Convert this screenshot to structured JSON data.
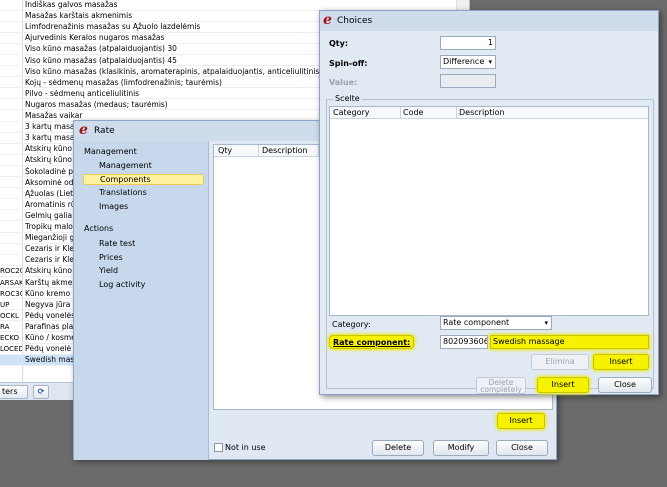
{
  "background_list": {
    "rows": [
      {
        "code": "",
        "name": "Indiškas galvos masažas"
      },
      {
        "code": "",
        "name": "Masažas karštais akmenimis"
      },
      {
        "code": "",
        "name": "Limfodrenažinis masažas su Ąžuolo lazdelėmis"
      },
      {
        "code": "",
        "name": "Ajurvedinis Keralos nugaros masažas"
      },
      {
        "code": "",
        "name": "Viso kūno masažas (atpalaiduojantis) 30"
      },
      {
        "code": "",
        "name": "Viso kūno masažas (atpalaiduojantis) 45"
      },
      {
        "code": "",
        "name": "Viso kūno masažas (klasikinis, aromaterapinis, atpalaiduojantis, anticeliulitinis)"
      },
      {
        "code": "",
        "name": "Kojų - sėdmenų masažas (limfodrenažinis; taurėmis)"
      },
      {
        "code": "",
        "name": "Pilvo - sėdmenų anticeliulitinis"
      },
      {
        "code": "",
        "name": "Nugaros masažas (medaus; taurėmis)"
      },
      {
        "code": "",
        "name": "Masažas vaikar"
      },
      {
        "code": "",
        "name": "3 kartų masaž"
      },
      {
        "code": "",
        "name": "3 kartų masaž"
      },
      {
        "code": "",
        "name": "Atskirų kūno d"
      },
      {
        "code": "",
        "name": "Atskirų kūno d"
      },
      {
        "code": "",
        "name": "Šokoladinė pas"
      },
      {
        "code": "",
        "name": "Aksominė oda"
      },
      {
        "code": "",
        "name": "Ąžuolas (Lietuv"
      },
      {
        "code": "",
        "name": "Aromatinis rūka"
      },
      {
        "code": "",
        "name": "Gelmių galia"
      },
      {
        "code": "",
        "name": "Tropikų malonu"
      },
      {
        "code": "",
        "name": "Mieganžioji gra"
      },
      {
        "code": "",
        "name": "Cezaris ir Kleop"
      },
      {
        "code": "",
        "name": "Cezaris ir Kleop"
      },
      {
        "code": "ROC20",
        "name": "Atskirų kūno da"
      },
      {
        "code": "ARSAK",
        "name": "Karštų akmenų"
      },
      {
        "code": "ROC30",
        "name": "Kūno kremo įm"
      },
      {
        "code": "UP",
        "name": "Negyva jūra 30"
      },
      {
        "code": "OCKL",
        "name": "Pėdų vonelės 3"
      },
      {
        "code": "RA",
        "name": "Parafinas plašt"
      },
      {
        "code": "ECKO",
        "name": "Kūno / kosmet"
      },
      {
        "code": "LOCED",
        "name": "Pėdų vonelė 2"
      },
      {
        "code": "",
        "name": "Swedish massa"
      }
    ],
    "filters_label": "ters",
    "refresh_icon": "refresh-icon"
  },
  "rate_window": {
    "title": "Rate",
    "logo": "e",
    "nav": {
      "management_header": "Management",
      "management_items": [
        "Management",
        "Components",
        "Translations",
        "Images"
      ],
      "actions_header": "Actions",
      "action_items": [
        "Rate test",
        "Prices",
        "Yield",
        "Log activity"
      ]
    },
    "table_headers": [
      "Qty",
      "Description"
    ],
    "insert_label": "Insert",
    "not_in_use_label": "Not in use",
    "delete_label": "Delete",
    "modify_label": "Modify",
    "close_label": "Close"
  },
  "choices_dialog": {
    "title": "Choices",
    "logo": "e",
    "qty_label": "Qty:",
    "qty_value": "1",
    "spinoff_label": "Spin-off:",
    "spinoff_value": "Difference",
    "value_label": "Value:",
    "value_value": "",
    "group_title": "Scelte",
    "table_headers": [
      "Category",
      "Code",
      "Description"
    ],
    "category_label": "Category:",
    "category_value": "Rate component",
    "rate_component_label": "Rate component:",
    "rate_component_code": "8020936065",
    "rate_component_name": "Swedish massage",
    "elimina_label": "Elimina",
    "insert_inner_label": "Insert",
    "delete_completely_label": "Delete completely",
    "insert_label": "Insert",
    "close_label": "Close"
  },
  "colors": {
    "highlight": "#f7f200",
    "logo_red": "#a31212",
    "nav_bg": "#c8d8ec",
    "dialog_bg": "#e1e9f3"
  }
}
